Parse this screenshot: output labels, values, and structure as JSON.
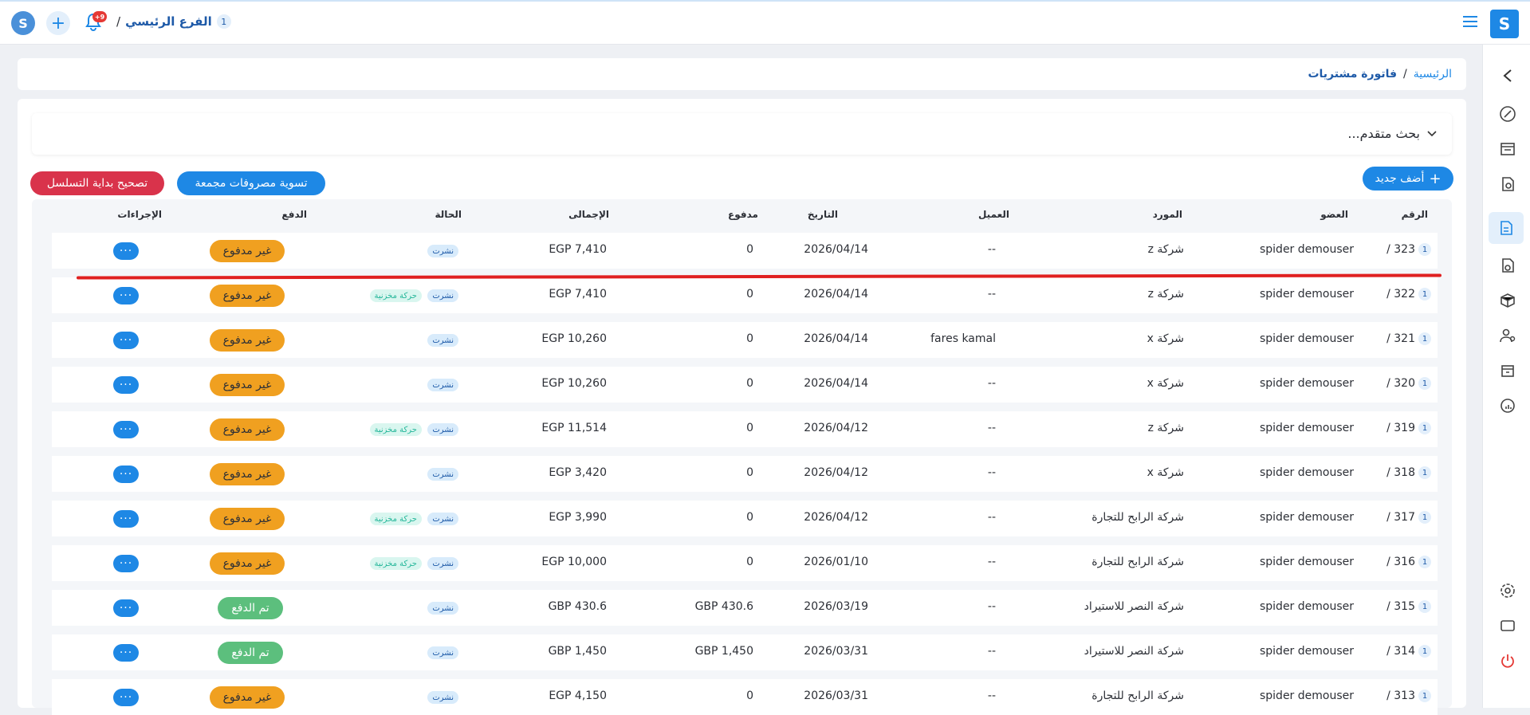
{
  "header": {
    "branch_number": "1",
    "branch_name": "الفرع الرئيسي",
    "branch_slash": "/",
    "notifications_count": "+9"
  },
  "breadcrumb": {
    "home": "الرئيسية",
    "sep": "/",
    "current": "فاتورة مشتريات"
  },
  "search": {
    "label": "بحث متقدم..."
  },
  "buttons": {
    "add_new": "أضف جديد",
    "settle": "تسوية مصروفات مجمعة",
    "fix": "تصحيح بداية التسلسل"
  },
  "columns": {
    "number": "الرقم",
    "member": "العضو",
    "supplier": "المورد",
    "client": "العميل",
    "date": "التاريخ",
    "paid": "مدفوع",
    "total": "الإجمالى",
    "status": "الحالة",
    "payment": "الدفع",
    "actions": "الإجراءات"
  },
  "tags": {
    "published": "نشرت",
    "stock": "حركة مخزنية",
    "unpaid": "غير مدفوع",
    "paid": "تم الدفع",
    "more": "···"
  },
  "rows": [
    {
      "badge": "1",
      "number": "323 /",
      "member": "spider demouser",
      "supplier": "شركة z",
      "client": "--",
      "date": "2026/04/14",
      "paid": "0",
      "total": "EGP 7,410",
      "stock": false,
      "payment": "unpaid"
    },
    {
      "badge": "1",
      "number": "322 /",
      "member": "spider demouser",
      "supplier": "شركة z",
      "client": "--",
      "date": "2026/04/14",
      "paid": "0",
      "total": "EGP 7,410",
      "stock": true,
      "payment": "unpaid"
    },
    {
      "badge": "1",
      "number": "321 /",
      "member": "spider demouser",
      "supplier": "شركة x",
      "client": "fares kamal",
      "date": "2026/04/14",
      "paid": "0",
      "total": "EGP 10,260",
      "stock": false,
      "payment": "unpaid"
    },
    {
      "badge": "1",
      "number": "320 /",
      "member": "spider demouser",
      "supplier": "شركة x",
      "client": "--",
      "date": "2026/04/14",
      "paid": "0",
      "total": "EGP 10,260",
      "stock": false,
      "payment": "unpaid"
    },
    {
      "badge": "1",
      "number": "319 /",
      "member": "spider demouser",
      "supplier": "شركة z",
      "client": "--",
      "date": "2026/04/12",
      "paid": "0",
      "total": "EGP 11,514",
      "stock": true,
      "payment": "unpaid"
    },
    {
      "badge": "1",
      "number": "318 /",
      "member": "spider demouser",
      "supplier": "شركة x",
      "client": "--",
      "date": "2026/04/12",
      "paid": "0",
      "total": "EGP 3,420",
      "stock": false,
      "payment": "unpaid"
    },
    {
      "badge": "1",
      "number": "317 /",
      "member": "spider demouser",
      "supplier": "شركة الرابح للتجارة",
      "client": "--",
      "date": "2026/04/12",
      "paid": "0",
      "total": "EGP 3,990",
      "stock": true,
      "payment": "unpaid"
    },
    {
      "badge": "1",
      "number": "316 /",
      "member": "spider demouser",
      "supplier": "شركة الرابح للتجارة",
      "client": "--",
      "date": "2026/01/10",
      "paid": "0",
      "total": "EGP 10,000",
      "stock": true,
      "payment": "unpaid"
    },
    {
      "badge": "1",
      "number": "315 /",
      "member": "spider demouser",
      "supplier": "شركة النصر للاستيراد",
      "client": "--",
      "date": "2026/03/19",
      "paid": "GBP 430.6",
      "total": "GBP 430.6",
      "stock": false,
      "payment": "paid"
    },
    {
      "badge": "1",
      "number": "314 /",
      "member": "spider demouser",
      "supplier": "شركة النصر للاستيراد",
      "client": "--",
      "date": "2026/03/31",
      "paid": "GBP 1,450",
      "total": "GBP 1,450",
      "stock": false,
      "payment": "paid"
    },
    {
      "badge": "1",
      "number": "313 /",
      "member": "spider demouser",
      "supplier": "شركة الرابح للتجارة",
      "client": "--",
      "date": "2026/03/31",
      "paid": "0",
      "total": "EGP 4,150",
      "stock": false,
      "payment": "unpaid"
    }
  ]
}
